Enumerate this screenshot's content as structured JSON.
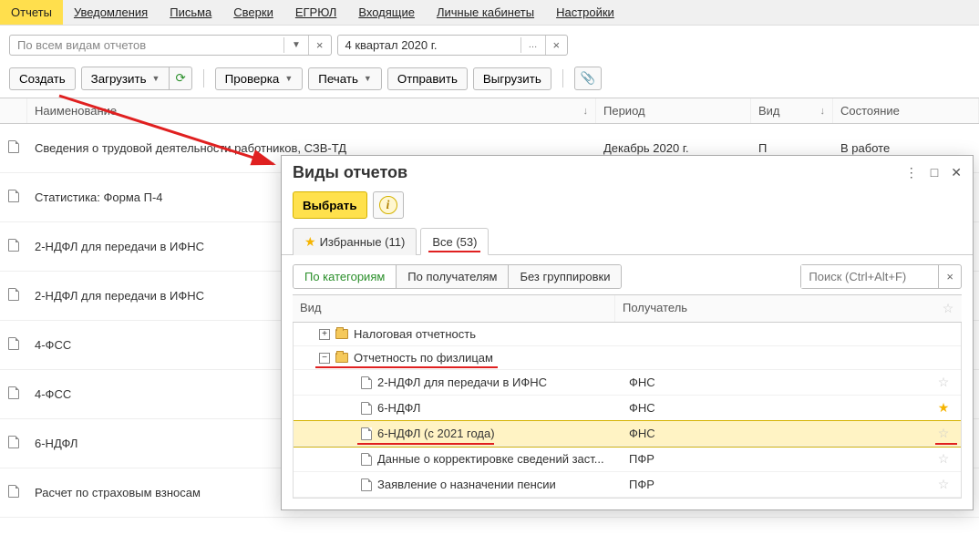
{
  "nav": {
    "reports": "Отчеты",
    "notifications": "Уведомления",
    "letters": "Письма",
    "reconciliations": "Сверки",
    "egrul": "ЕГРЮЛ",
    "incoming": "Входящие",
    "cabinets": "Личные кабинеты",
    "settings": "Настройки"
  },
  "filter": {
    "type_placeholder": "По всем видам отчетов",
    "period": "4 квартал 2020 г."
  },
  "toolbar": {
    "create": "Создать",
    "load": "Загрузить",
    "check": "Проверка",
    "print": "Печать",
    "send": "Отправить",
    "export": "Выгрузить"
  },
  "columns": {
    "name": "Наименование",
    "period": "Период",
    "vid": "Вид",
    "state": "Состояние"
  },
  "rows": [
    {
      "name": "Сведения о трудовой деятельности работников, СЗВ-ТД",
      "period": "Декабрь 2020 г.",
      "vid": "П",
      "state": "В работе"
    },
    {
      "name": "Статистика: Форма П-4",
      "period": "",
      "vid": "",
      "state": ""
    },
    {
      "name": "2-НДФЛ для передачи в ИФНС",
      "period": "",
      "vid": "",
      "state": ""
    },
    {
      "name": "2-НДФЛ для передачи в ИФНС",
      "period": "",
      "vid": "",
      "state": ""
    },
    {
      "name": "4-ФСС",
      "period": "",
      "vid": "",
      "state": ""
    },
    {
      "name": "4-ФСС",
      "period": "",
      "vid": "",
      "state": ""
    },
    {
      "name": "6-НДФЛ",
      "period": "",
      "vid": "",
      "state": ""
    },
    {
      "name": "Расчет по страховым взносам",
      "period": "",
      "vid": "",
      "state": ""
    }
  ],
  "modal": {
    "title": "Виды отчетов",
    "select": "Выбрать",
    "tab_fav": "Избранные (11)",
    "tab_all": "Все (53)",
    "sub_cat": "По категориям",
    "sub_recv": "По получателям",
    "sub_none": "Без группировки",
    "search_placeholder": "Поиск (Ctrl+Alt+F)",
    "col_vid": "Вид",
    "col_recv": "Получатель",
    "tree": {
      "tax": "Налоговая отчетность",
      "persons": "Отчетность по физлицам",
      "items": [
        {
          "name": "2-НДФЛ для передачи в ИФНС",
          "recv": "ФНС",
          "star": false
        },
        {
          "name": "6-НДФЛ",
          "recv": "ФНС",
          "star": true
        },
        {
          "name": "6-НДФЛ (с 2021 года)",
          "recv": "ФНС",
          "star": false
        },
        {
          "name": "Данные о корректировке сведений заст...",
          "recv": "ПФР",
          "star": false
        },
        {
          "name": "Заявление о назначении пенсии",
          "recv": "ПФР",
          "star": false
        }
      ]
    }
  }
}
